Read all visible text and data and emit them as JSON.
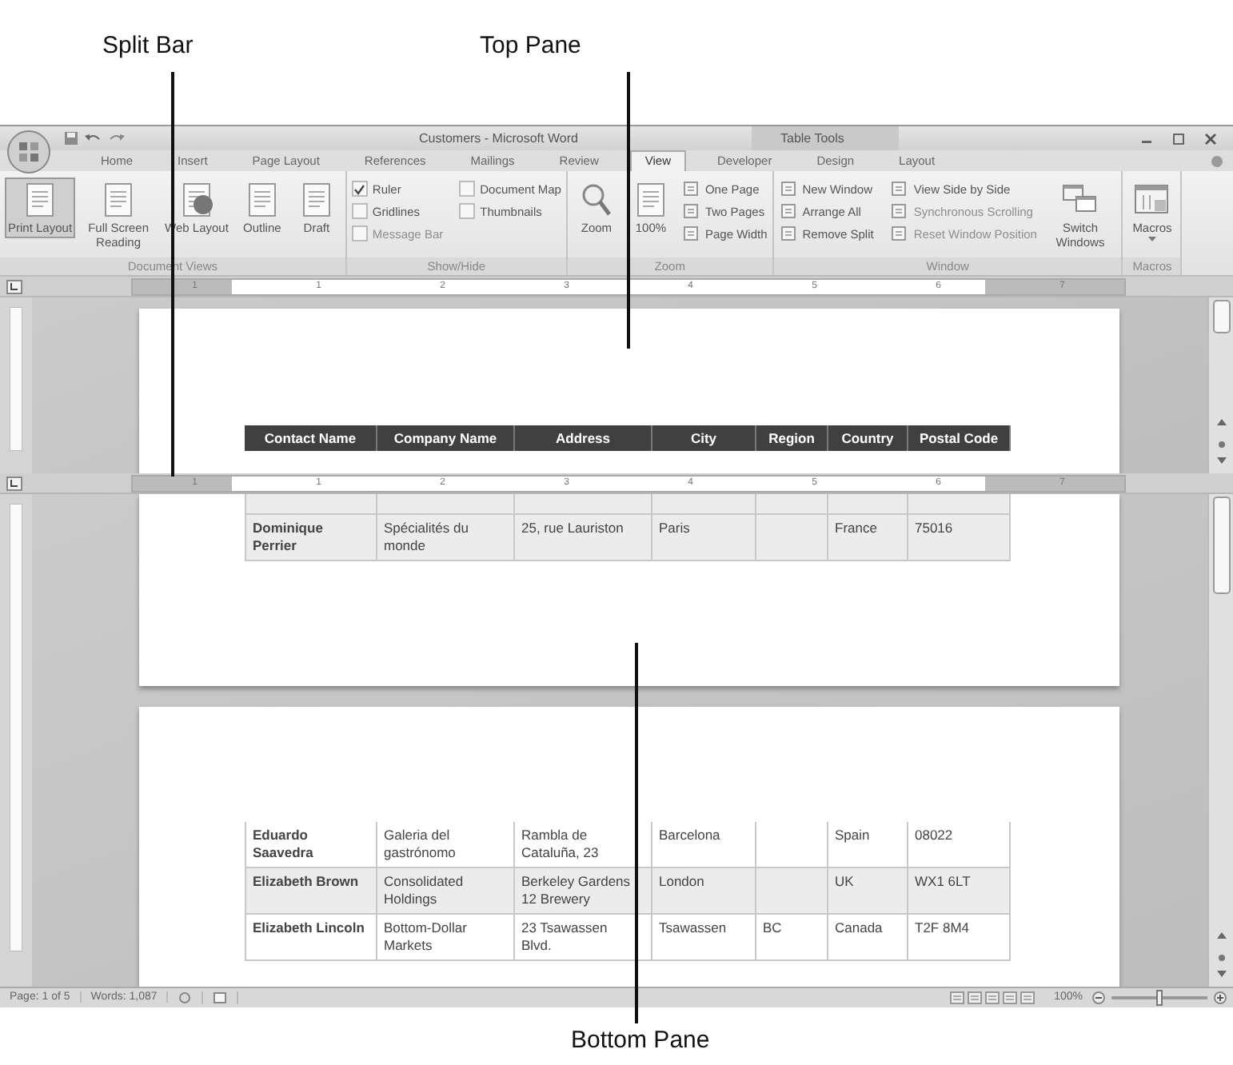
{
  "callouts": [
    {
      "label": "Split Bar"
    },
    {
      "label": "Top Pane"
    },
    {
      "label": "Bottom Pane"
    }
  ],
  "window": {
    "title": "Customers - Microsoft Word",
    "context_label": "Table Tools"
  },
  "tabs": [
    {
      "label": "Home",
      "selected": false
    },
    {
      "label": "Insert",
      "selected": false
    },
    {
      "label": "Page Layout",
      "selected": false
    },
    {
      "label": "References",
      "selected": false
    },
    {
      "label": "Mailings",
      "selected": false
    },
    {
      "label": "Review",
      "selected": false
    },
    {
      "label": "View",
      "selected": true
    },
    {
      "label": "Developer",
      "selected": false
    },
    {
      "label": "Design",
      "selected": false
    },
    {
      "label": "Layout",
      "selected": false
    }
  ],
  "ribbon": [
    {
      "label": "Document Views",
      "items": [
        {
          "kind": "large",
          "label": "Print Layout",
          "selected": true
        },
        {
          "kind": "large",
          "label": "Full Screen Reading",
          "selected": false
        },
        {
          "kind": "large",
          "label": "Web Layout",
          "selected": false
        },
        {
          "kind": "large",
          "label": "Outline",
          "selected": false
        },
        {
          "kind": "large",
          "label": "Draft",
          "selected": false
        }
      ]
    },
    {
      "label": "Show/Hide",
      "items": [
        {
          "kind": "check",
          "label": "Ruler",
          "checked": true,
          "disabled": false
        },
        {
          "kind": "check",
          "label": "Gridlines",
          "checked": false,
          "disabled": false
        },
        {
          "kind": "check",
          "label": "Message Bar",
          "checked": false,
          "disabled": true
        },
        {
          "kind": "check",
          "label": "Document Map",
          "checked": false,
          "disabled": false
        },
        {
          "kind": "check",
          "label": "Thumbnails",
          "checked": false,
          "disabled": false
        }
      ]
    },
    {
      "label": "Zoom",
      "items": [
        {
          "kind": "large",
          "label": "Zoom"
        },
        {
          "kind": "large",
          "label": "100%"
        },
        {
          "kind": "small",
          "label": "One Page",
          "disabled": false
        },
        {
          "kind": "small",
          "label": "Two Pages",
          "disabled": false
        },
        {
          "kind": "small",
          "label": "Page Width",
          "disabled": false
        }
      ]
    },
    {
      "label": "Window",
      "items": [
        {
          "kind": "small",
          "label": "New Window",
          "disabled": false
        },
        {
          "kind": "small",
          "label": "Arrange All",
          "disabled": false
        },
        {
          "kind": "small",
          "label": "Remove Split",
          "disabled": false
        },
        {
          "kind": "small",
          "label": "View Side by Side",
          "disabled": false
        },
        {
          "kind": "small",
          "label": "Synchronous Scrolling",
          "disabled": true
        },
        {
          "kind": "small",
          "label": "Reset Window Position",
          "disabled": true
        },
        {
          "kind": "large",
          "label": "Switch Windows"
        }
      ]
    },
    {
      "label": "Macros",
      "items": [
        {
          "kind": "large",
          "label": "Macros"
        }
      ]
    }
  ],
  "ruler": {
    "marks": [
      "1",
      "1",
      "2",
      "3",
      "4",
      "5",
      "6",
      "7"
    ]
  },
  "split_ruler": {
    "marks": [
      "1",
      "1",
      "2",
      "3",
      "4",
      "5",
      "6",
      "7"
    ]
  },
  "table": {
    "columns": [
      "Contact Name",
      "Company Name",
      "Address",
      "City",
      "Region",
      "Country",
      "Postal Code"
    ]
  },
  "bottom_pane": {
    "page_1_rows": [
      {
        "shaded": true,
        "cells": [
          "Dominique Perrier",
          "Spécialités du monde",
          "25, rue Lauriston",
          "Paris",
          "",
          "France",
          "75016"
        ]
      }
    ],
    "page_2_rows": [
      {
        "shaded": false,
        "cells": [
          "Eduardo Saavedra",
          "Galeria del gastrónomo",
          "Rambla de Cataluña, 23",
          "Barcelona",
          "",
          "Spain",
          "08022"
        ]
      },
      {
        "shaded": true,
        "cells": [
          "Elizabeth Brown",
          "Consolidated Holdings",
          "Berkeley Gardens 12 Brewery",
          "London",
          "",
          "UK",
          "WX1 6LT"
        ]
      },
      {
        "shaded": false,
        "cells": [
          "Elizabeth Lincoln",
          "Bottom-Dollar Markets",
          "23 Tsawassen Blvd.",
          "Tsawassen",
          "BC",
          "Canada",
          "T2F 8M4"
        ]
      }
    ]
  },
  "status_bar": {
    "page": "Page: 1 of 5",
    "words": "Words: 1,087",
    "zoom": "100%",
    "zoom_slider": {
      "level": 0.5
    }
  }
}
